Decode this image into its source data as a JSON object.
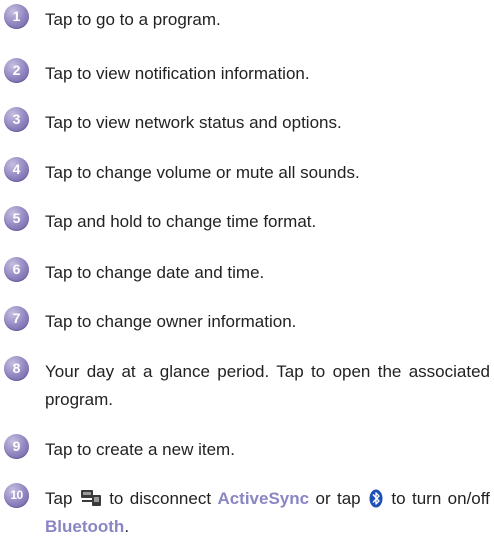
{
  "items": [
    {
      "number": "1",
      "text": "Tap to go to a program."
    },
    {
      "number": "2",
      "text": "Tap to view notification information."
    },
    {
      "number": "3",
      "text": "Tap to view network status and options."
    },
    {
      "number": "4",
      "text": "Tap to change volume or mute all sounds."
    },
    {
      "number": "5",
      "text": "Tap and hold to change time format."
    },
    {
      "number": "6",
      "text": "Tap to change date and time."
    },
    {
      "number": "7",
      "text": "Tap to change owner information."
    },
    {
      "number": "8",
      "text": "Your day at a glance period. Tap to open the associated program."
    },
    {
      "number": "9",
      "text": "Tap to create a new item."
    },
    {
      "number": "10",
      "parts": {
        "tap1": "Tap",
        "mid1": "to disconnect",
        "activesync": "ActiveSync",
        "mid2": "or tap",
        "mid3": "to turn on/off",
        "bluetooth": "Bluetooth",
        "end": "."
      },
      "icons": [
        "activesync-icon",
        "bluetooth-icon"
      ]
    }
  ],
  "colors": {
    "badge": "#8f83bf",
    "highlight": "#8a86c4",
    "text": "#222222"
  }
}
